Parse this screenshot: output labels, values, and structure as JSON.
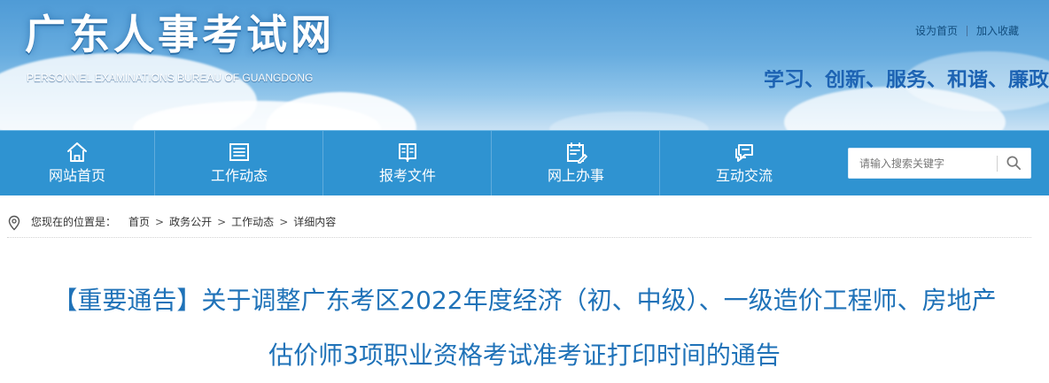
{
  "header": {
    "site_title": "广东人事考试网",
    "site_subtitle": "PERSONNEL EXAMINATIONS BUREAU OF GUANGDONG",
    "top_links": {
      "set_home": "设为首页",
      "add_favorite": "加入收藏"
    },
    "slogan": "学习、创新、服务、和谐、廉政"
  },
  "navigation": {
    "items": [
      {
        "label": "网站首页",
        "icon": "home-icon"
      },
      {
        "label": "工作动态",
        "icon": "news-list-icon"
      },
      {
        "label": "报考文件",
        "icon": "open-book-icon"
      },
      {
        "label": "网上办事",
        "icon": "online-service-icon"
      },
      {
        "label": "互动交流",
        "icon": "chat-bubbles-icon"
      }
    ]
  },
  "search": {
    "placeholder": "请输入搜索关键字",
    "icon": "search-icon"
  },
  "breadcrumb": {
    "prefix": "您现在的位置是：",
    "items": [
      "首页",
      "政务公开",
      "工作动态",
      "详细内容"
    ],
    "separator": ">",
    "icon": "location-pin-icon"
  },
  "article": {
    "title_line1": "【重要通告】关于调整广东考区2022年度经济（初、中级）、一级造价工程师、房地产",
    "title_line2": "估价师3项职业资格考试准考证打印时间的通告"
  },
  "colors": {
    "nav_background": "#2f93d1",
    "title_blue": "#1f72b8",
    "slogan_blue": "#1d63b3"
  }
}
